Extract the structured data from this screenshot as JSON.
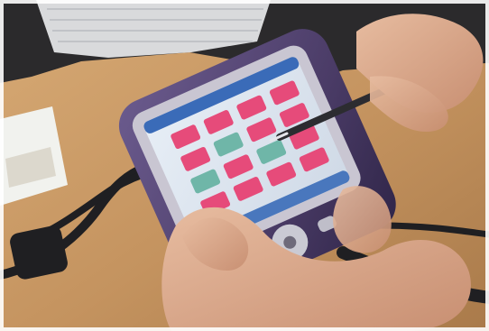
{
  "scene": {
    "palette": {
      "table_wood": "#c4935f",
      "table_shadow": "#8a5a35",
      "laptop_body": "#2b2a2c",
      "keyboard_keys": "#d9dadc",
      "pda_body": "#4b3c67",
      "pda_bezel": "#c9c6d2",
      "pda_screen": "#d9e6f2",
      "screen_titlebar": "#3a6bb8",
      "tile_pink": "#e64b7a",
      "tile_teal": "#6fb6a8",
      "skin": "#d8a889",
      "cable": "#1f1f22",
      "stylus": "#2c2c30",
      "box_white": "#f1f2ee"
    },
    "tile_grid": {
      "rows": 4,
      "cols": 4,
      "pattern": [
        [
          "pink",
          "pink",
          "pink",
          "pink"
        ],
        [
          "pink",
          "teal",
          "pink",
          "pink"
        ],
        [
          "teal",
          "pink",
          "teal",
          "pink"
        ],
        [
          "pink",
          "pink",
          "pink",
          "pink"
        ]
      ]
    }
  }
}
